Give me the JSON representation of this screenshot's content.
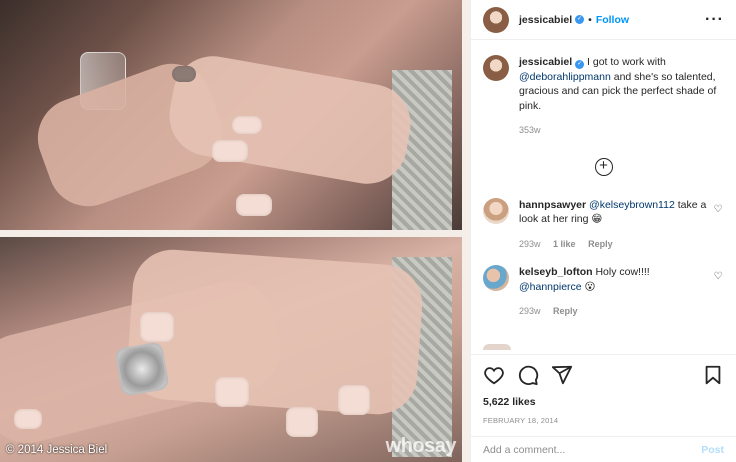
{
  "media": {
    "copyright": "© 2014 Jessica Biel",
    "watermark": "whosay"
  },
  "header": {
    "username": "jessicabiel",
    "separator": "•",
    "follow_label": "Follow",
    "more_icon": "more-horizontal-icon"
  },
  "caption": {
    "username": "jessicabiel",
    "text_before": " I got to work with ",
    "mention": "@deborahlippmann",
    "text_after": " and she's so talented, gracious and can pick the perfect shade of pink.",
    "time": "353w"
  },
  "load_more_icon": "plus-circle-icon",
  "comments": [
    {
      "username": "hannpsawyer",
      "mention": "@kelseybrown112",
      "text": " take a look at her ring 😁",
      "time": "293w",
      "likes": "1 like",
      "reply": "Reply"
    },
    {
      "username": "kelseyb_lofton",
      "text_before": " Holy cow!!!! ",
      "mention": "@hannpierce",
      "text_after": " 😮",
      "time": "293w",
      "reply": "Reply"
    }
  ],
  "actions": {
    "likes": "5,622 likes",
    "date": "FEBRUARY 18, 2014"
  },
  "add_comment": {
    "placeholder": "Add a comment...",
    "post_label": "Post"
  },
  "colors": {
    "link": "#0095f6",
    "mention": "#00376b",
    "muted": "#8e8e8e",
    "verified": "#3897f0"
  }
}
